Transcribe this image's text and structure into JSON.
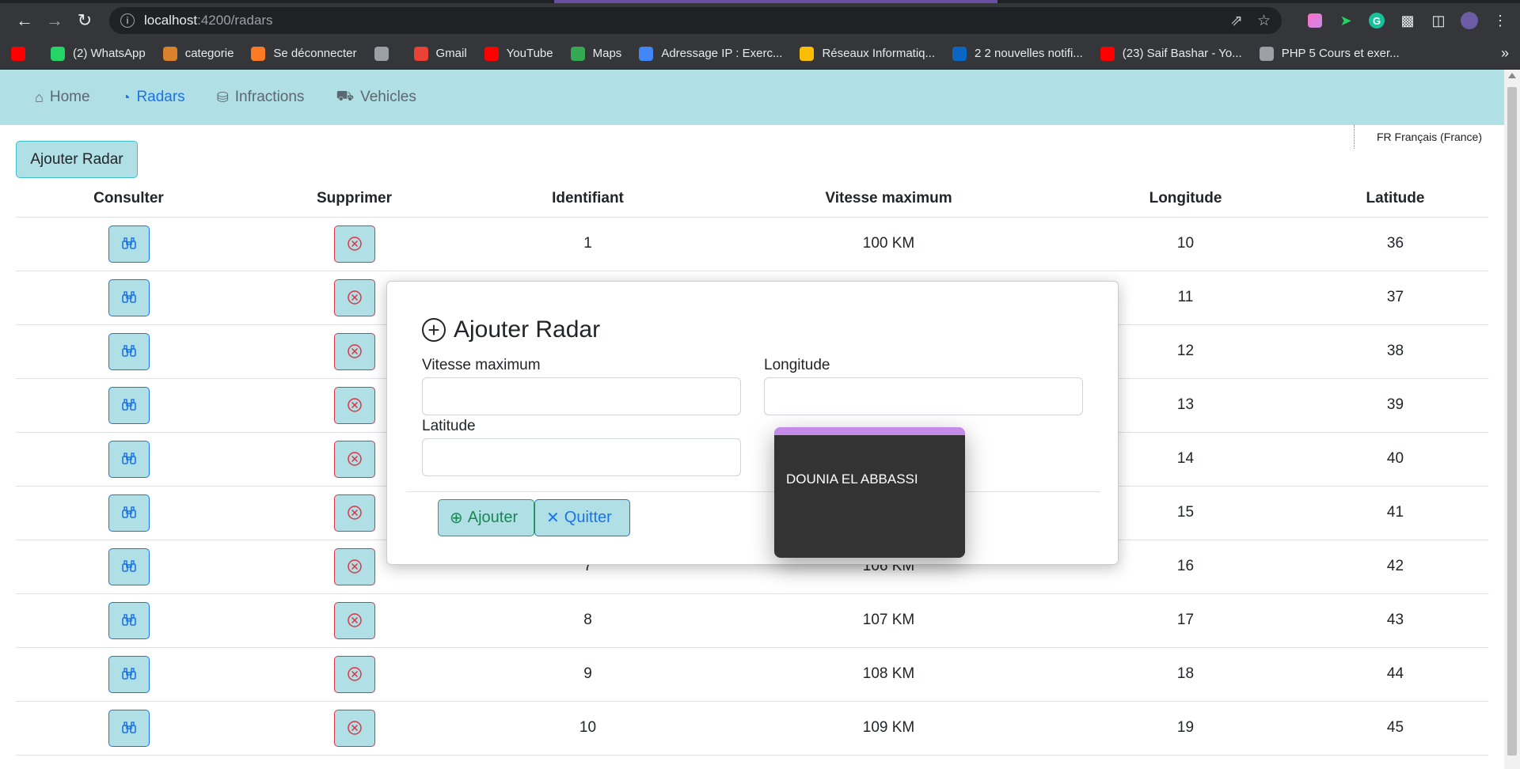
{
  "browser": {
    "url_host": "localhost",
    "url_path": ":4200/radars",
    "bookmarks": [
      {
        "label": "",
        "icon": "youtube-icon",
        "color": "#ff0000"
      },
      {
        "label": "(2) WhatsApp",
        "icon": "whatsapp-icon",
        "color": "#25d366"
      },
      {
        "label": "categorie",
        "icon": "categorie-icon",
        "color": "#d9822b"
      },
      {
        "label": "Se déconnecter",
        "icon": "xampp-icon",
        "color": "#fb7a24"
      },
      {
        "label": "",
        "icon": "globe-icon",
        "color": "#9aa0a6"
      },
      {
        "label": "Gmail",
        "icon": "gmail-icon",
        "color": "#ea4335"
      },
      {
        "label": "YouTube",
        "icon": "youtube-icon",
        "color": "#ff0000"
      },
      {
        "label": "Maps",
        "icon": "maps-icon",
        "color": "#34a853"
      },
      {
        "label": "Adressage IP : Exerc...",
        "icon": "adressage-icon",
        "color": "#4285f4"
      },
      {
        "label": "Réseaux Informatiq...",
        "icon": "drive-icon",
        "color": "#fbbc04"
      },
      {
        "label": "2 2 nouvelles notifi...",
        "icon": "linkedin-icon",
        "color": "#0a66c2"
      },
      {
        "label": "(23) Saif Bashar - Yo...",
        "icon": "youtube-icon",
        "color": "#ff0000"
      },
      {
        "label": "PHP 5 Cours et exer...",
        "icon": "globe-icon",
        "color": "#9aa0a6"
      }
    ],
    "more": "»"
  },
  "nav": {
    "items": [
      {
        "label": "Home",
        "icon": "home-icon"
      },
      {
        "label": "Radars",
        "icon": "radar-icon"
      },
      {
        "label": "Infractions",
        "icon": "database-icon"
      },
      {
        "label": "Vehicles",
        "icon": "car-icon"
      }
    ],
    "active": "Radars"
  },
  "language": "FR Français (France)",
  "add_button": "Ajouter Radar",
  "table": {
    "headers": [
      "Consulter",
      "Supprimer",
      "Identifiant",
      "Vitesse maximum",
      "Longitude",
      "Latitude"
    ],
    "rows": [
      {
        "id": "1",
        "speed": "100 KM",
        "lon": "10",
        "lat": "36"
      },
      {
        "id": "",
        "speed": "",
        "lon": "11",
        "lat": "37"
      },
      {
        "id": "",
        "speed": "",
        "lon": "12",
        "lat": "38"
      },
      {
        "id": "",
        "speed": "",
        "lon": "13",
        "lat": "39"
      },
      {
        "id": "",
        "speed": "",
        "lon": "14",
        "lat": "40"
      },
      {
        "id": "",
        "speed": "",
        "lon": "15",
        "lat": "41"
      },
      {
        "id": "7",
        "speed": "106 KM",
        "lon": "16",
        "lat": "42"
      },
      {
        "id": "8",
        "speed": "107 KM",
        "lon": "17",
        "lat": "43"
      },
      {
        "id": "9",
        "speed": "108 KM",
        "lon": "18",
        "lat": "44"
      },
      {
        "id": "10",
        "speed": "109 KM",
        "lon": "19",
        "lat": "45"
      }
    ]
  },
  "modal": {
    "title": "Ajouter Radar",
    "speed_label": "Vitesse maximum",
    "lon_label": "Longitude",
    "lat_label": "Latitude",
    "speed_value": "",
    "lon_value": "",
    "lat_value": "",
    "ok_label": "Ajouter",
    "quit_label": "Quitter"
  },
  "popup": {
    "name": "DOUNIA EL ABBASSI",
    "accent": "#c58be8"
  },
  "colors": {
    "nav_bg": "#b0dfe5",
    "link_active": "#1a73e8",
    "delete": "#dc3545",
    "success": "#198754"
  }
}
